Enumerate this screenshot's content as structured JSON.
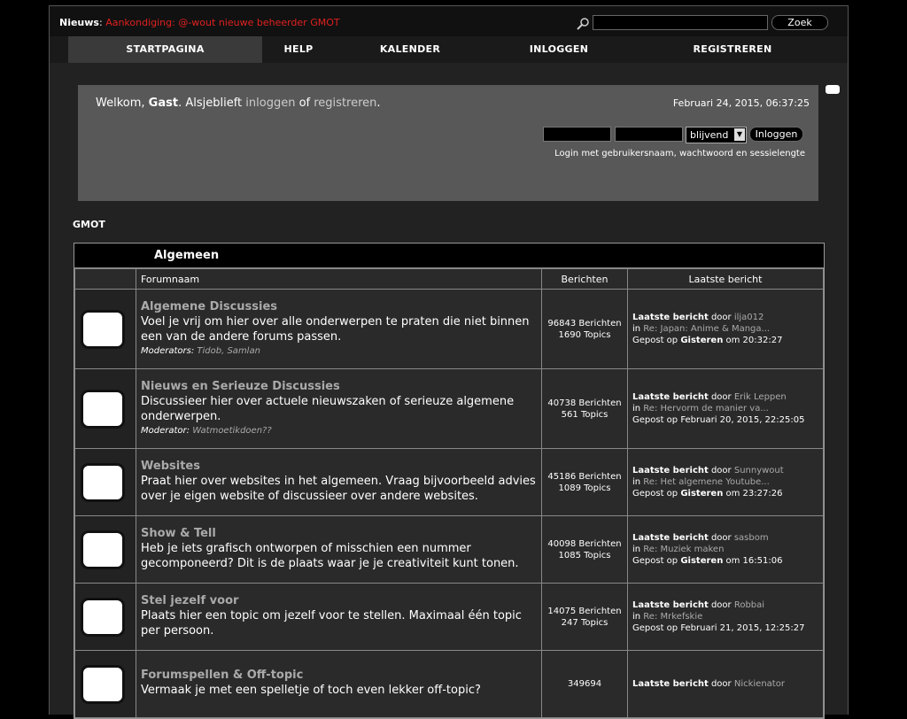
{
  "news": {
    "label": "Nieuws",
    "text": "Aankondiging: @-wout nieuwe beheerder GMOT"
  },
  "search": {
    "placeholder": "",
    "button": "Zoek"
  },
  "menu": [
    "STARTPAGINA",
    "HELP",
    "KALENDER",
    "INLOGGEN",
    "REGISTREREN"
  ],
  "userbox": {
    "welcome_pre": "Welkom, ",
    "guest": "Gast",
    "welcome_mid": ". Alsjeblieft ",
    "login_link": "inloggen",
    "or": " of ",
    "register_link": "registreren",
    "dot": ".",
    "date": "Februari 24, 2015, 06:37:25",
    "session_select": "blijvend",
    "login_button": "Inloggen",
    "hint": "Login met gebruikersnaam, wachtwoord en sessielengte"
  },
  "breadcrumb": "GMOT",
  "category": "Algemeen",
  "columns": {
    "name": "Forumnaam",
    "posts": "Berichten",
    "last": "Laatste bericht"
  },
  "boards": [
    {
      "name": "Algemene Discussies",
      "desc": "Voel je vrij om hier over alle onderwerpen te praten die niet binnen een van de andere forums passen.",
      "mod_label": "Moderators: ",
      "mods": "Tidob, Samlan",
      "posts": "96843 Berichten",
      "topics": "1690 Topics",
      "last_label": "Laatste bericht",
      "by": " door ",
      "user": "ilja012",
      "in": "in ",
      "topic": "Re: Japan: Anime & Manga...",
      "posted": "Gepost op ",
      "day": "Gisteren",
      "time": " om 20:32:27"
    },
    {
      "name": "Nieuws en Serieuze Discussies",
      "desc": "Discussieer hier over actuele nieuwszaken of serieuze algemene onderwerpen.",
      "mod_label": "Moderator: ",
      "mods": "Watmoetikdoen??",
      "posts": "40738 Berichten",
      "topics": "561 Topics",
      "last_label": "Laatste bericht",
      "by": " door ",
      "user": "Erik Leppen",
      "in": "in ",
      "topic": "Re: Hervorm de manier va...",
      "posted": "Gepost op Februari 20, 2015, 22:25:05",
      "day": "",
      "time": ""
    },
    {
      "name": "Websites",
      "desc": "Praat hier over websites in het algemeen. Vraag bijvoorbeeld advies over je eigen website of discussieer over andere websites.",
      "mod_label": "",
      "mods": "",
      "posts": "45186 Berichten",
      "topics": "1089 Topics",
      "last_label": "Laatste bericht",
      "by": " door ",
      "user": "Sunnywout",
      "in": "in ",
      "topic": "Re: Het algemene Youtube...",
      "posted": "Gepost op ",
      "day": "Gisteren",
      "time": " om 23:27:26"
    },
    {
      "name": "Show & Tell",
      "desc": "Heb je iets grafisch ontworpen of misschien een nummer gecomponeerd? Dit is de plaats waar je je creativiteit kunt tonen.",
      "mod_label": "",
      "mods": "",
      "posts": "40098 Berichten",
      "topics": "1085 Topics",
      "last_label": "Laatste bericht",
      "by": " door ",
      "user": "sasbom",
      "in": "in ",
      "topic": "Re: Muziek maken",
      "posted": "Gepost op ",
      "day": "Gisteren",
      "time": " om 16:51:06"
    },
    {
      "name": "Stel jezelf voor",
      "desc": "Plaats hier een topic om jezelf voor te stellen. Maximaal één topic per persoon.",
      "mod_label": "",
      "mods": "",
      "posts": "14075 Berichten",
      "topics": "247 Topics",
      "last_label": "Laatste bericht",
      "by": " door ",
      "user": "Robbai",
      "in": "in ",
      "topic": "Re: Mrkefskie",
      "posted": "Gepost op Februari 21, 2015, 12:25:27",
      "day": "",
      "time": ""
    },
    {
      "name": "Forumspellen & Off-topic",
      "desc": "Vermaak je met een spelletje of toch even lekker off-topic?",
      "mod_label": "",
      "mods": "",
      "posts": "349694",
      "topics": "",
      "last_label": "Laatste bericht",
      "by": " door ",
      "user": "Nickienator",
      "in": "",
      "topic": "",
      "posted": "",
      "day": "",
      "time": ""
    }
  ]
}
